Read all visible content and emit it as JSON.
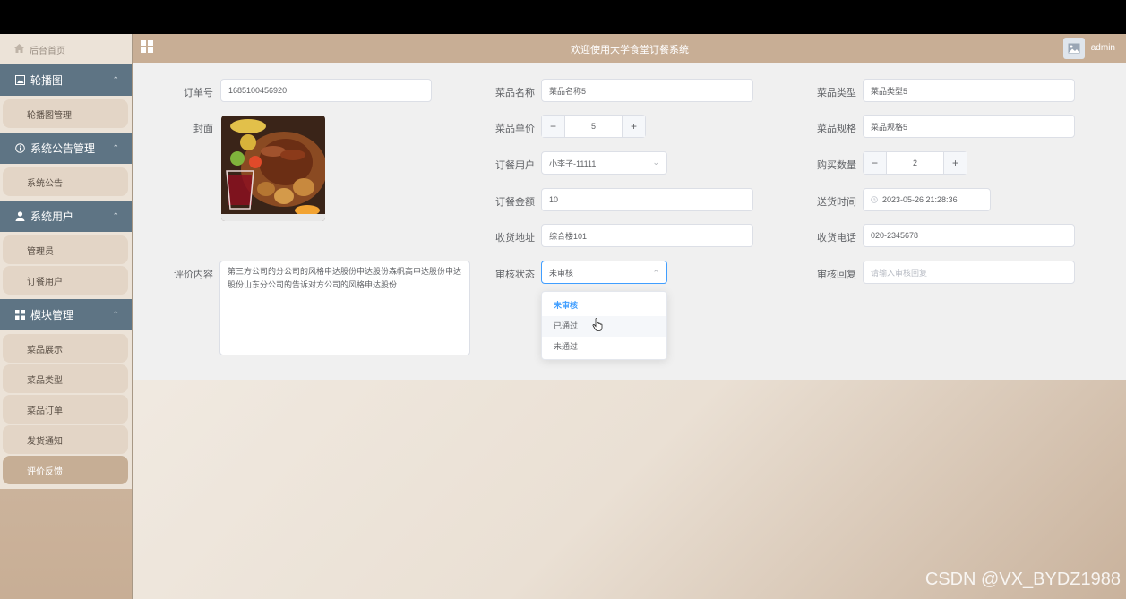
{
  "header": {
    "title": "欢迎使用大学食堂订餐系统",
    "username": "admin"
  },
  "sidebar": {
    "home": "后台首页",
    "groups": [
      {
        "label": "轮播图",
        "items": [
          "轮播图管理"
        ]
      },
      {
        "label": "系统公告管理",
        "items": [
          "系统公告"
        ]
      },
      {
        "label": "系统用户",
        "items": [
          "管理员",
          "订餐用户"
        ]
      },
      {
        "label": "模块管理",
        "items": [
          "菜品展示",
          "菜品类型",
          "菜品订单",
          "发货通知",
          "评价反馈"
        ]
      }
    ],
    "active_item": "评价反馈"
  },
  "form": {
    "order_no_label": "订单号",
    "order_no": "1685100456920",
    "cover_label": "封面",
    "review_label": "评价内容",
    "review": "第三方公司的分公司的风格申达股份申达股份森帆高申达股份申达股份山东分公司的告诉对方公司的风格申达股份",
    "dish_name_label": "菜品名称",
    "dish_name": "菜品名称5",
    "dish_price_label": "菜品单价",
    "dish_price": "5",
    "order_user_label": "订餐用户",
    "order_user": "小李子-11111",
    "amount_label": "订餐金额",
    "amount": "10",
    "address_label": "收货地址",
    "address": "综合楼101",
    "audit_status_label": "审核状态",
    "audit_status": "未审核",
    "audit_options": [
      "未审核",
      "已通过",
      "未通过"
    ],
    "dish_type_label": "菜品类型",
    "dish_type": "菜品类型5",
    "dish_spec_label": "菜品规格",
    "dish_spec": "菜品规格5",
    "qty_label": "购买数量",
    "qty": "2",
    "delivery_time_label": "送货时间",
    "delivery_time": "2023-05-26 21:28:36",
    "phone_label": "收货电话",
    "phone": "020-2345678",
    "audit_reply_label": "审核回复",
    "audit_reply_placeholder": "请输入审核回复"
  },
  "watermark": "CSDN @VX_BYDZ1988"
}
